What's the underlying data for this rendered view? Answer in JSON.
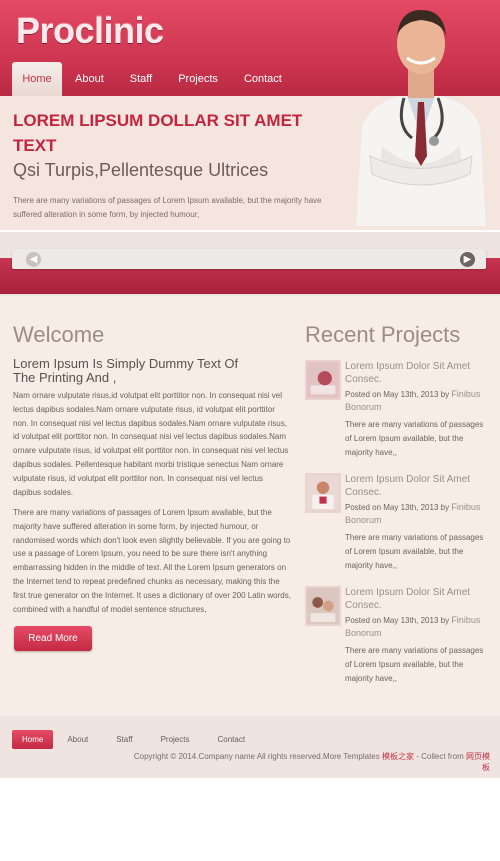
{
  "header": {
    "logo": "Proclinic",
    "nav": [
      "Home",
      "About",
      "Staff",
      "Projects",
      "Contact"
    ]
  },
  "hero": {
    "title": "LOREM LIPSUM DOLLAR SIT AMET TEXT",
    "subtitle": "Qsi Turpis,Pellentesque Ultrices",
    "text": "There are many variations of passages of Lorem Ipsum available, but the majority have suffered alteration in some form, by injected humour,"
  },
  "slider": {
    "prev_icon": "◀",
    "next_icon": "▶"
  },
  "welcome": {
    "title": "Welcome",
    "subtitle": "Lorem Ipsum Is Simply Dummy Text Of The Printing And ,",
    "para1": "Nam ornare vulputate risus,id volutpat elit porttitor non. In consequat nisi vel lectus dapibus sodales.Nam ornare vulputate risus, id volutpat elit porttitor non. In consequat nisi vel lectus dapibus sodales.Nam ornare vulputate risus, id volutpat elit porttitor non. In consequat nisi vel lectus dapibus sodales.Nam ornare vulputate risus, id volutpat elit porttitor non. In consequat nisi vel lectus dapibus sodales. Pellentesque habitant morbi tristique senectus Nam ornare vulputate risus, id volutpat elit porttitor non. In consequat nisi vel lectus dapibus sodales.",
    "para2": "There are many variations of passages of Lorem Ipsum available, but the majority have suffered alteration in some form, by injected humour, or randomised words which don't look even slightly believable. If you are going to use a passage of Lorem Ipsum, you need to be sure there isn't anything embarrassing hidden in the middle of text. All the Lorem Ipsum generators on the Internet tend to repeat predefined chunks as necessary, making this the first true generator on the Internet. It uses a dictionary of over 200 Latin words, combined with a handful of model sentence structures,",
    "read_more": "Read More"
  },
  "recent": {
    "title": "Recent Projects",
    "items": [
      {
        "title": "Lorem Ipsum Dolor Sit Amet Consec.",
        "date": "Posted on May 13th, 2013 by",
        "author": "Finibus Bonorum",
        "desc": "There are many variations of passages of Lorem Ipsum available, but the majority have,,"
      },
      {
        "title": "Lorem Ipsum Dolor Sit Amet Consec.",
        "date": "Posted on May 13th, 2013 by",
        "author": "Finibus Bonorum",
        "desc": "There are many variations of passages of Lorem Ipsum available, but the majority have,,"
      },
      {
        "title": "Lorem Ipsum Dolor Sit Amet Consec.",
        "date": "Posted on May 13th, 2013 by",
        "author": "Finibus Bonorum",
        "desc": "There are many variations of passages of Lorem Ipsum available, but the majority have,,"
      }
    ]
  },
  "footer": {
    "nav": [
      "Home",
      "About",
      "Staff",
      "Projects",
      "Contact"
    ],
    "copyright": "Copyright © 2014.Company name All rights reserved.More Templates",
    "link1": "模板之家",
    "separator": " - Collect from ",
    "link2": "网页模板"
  },
  "colors": {
    "brand_red": "#d03a53",
    "background": "#f7ece6"
  }
}
